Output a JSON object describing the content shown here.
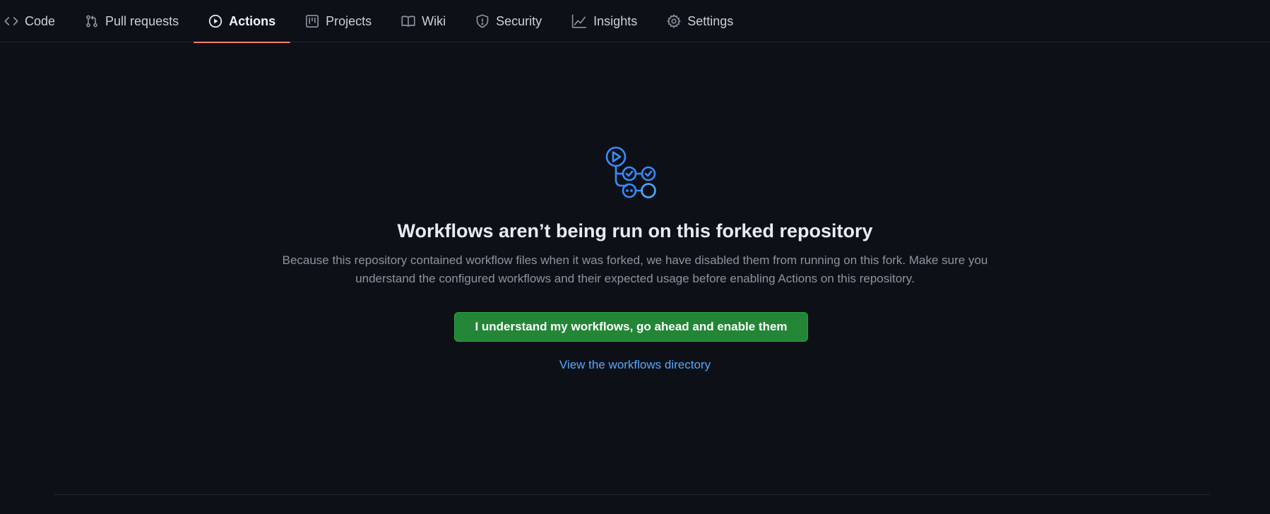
{
  "nav": {
    "tabs": [
      {
        "label": "Code",
        "icon": "code-icon",
        "active": false
      },
      {
        "label": "Pull requests",
        "icon": "git-pull-request-icon",
        "active": false
      },
      {
        "label": "Actions",
        "icon": "play-circle-icon",
        "active": true
      },
      {
        "label": "Projects",
        "icon": "project-board-icon",
        "active": false
      },
      {
        "label": "Wiki",
        "icon": "book-icon",
        "active": false
      },
      {
        "label": "Security",
        "icon": "shield-icon",
        "active": false
      },
      {
        "label": "Insights",
        "icon": "graph-icon",
        "active": false
      },
      {
        "label": "Settings",
        "icon": "gear-icon",
        "active": false
      }
    ]
  },
  "main": {
    "hero_icon": "workflow-icon",
    "headline": "Workflows aren’t being run on this forked repository",
    "description": "Because this repository contained workflow files when it was forked, we have disabled them from running on this fork. Make sure you understand the configured workflows and their expected usage before enabling Actions on this repository.",
    "enable_button_label": "I understand my workflows, go ahead and enable them",
    "workflows_link_label": "View the workflows directory"
  },
  "colors": {
    "background": "#0d1117",
    "active_tab_underline": "#f78166",
    "accent_blue": "#58a6ff",
    "primary_button": "#238636"
  }
}
